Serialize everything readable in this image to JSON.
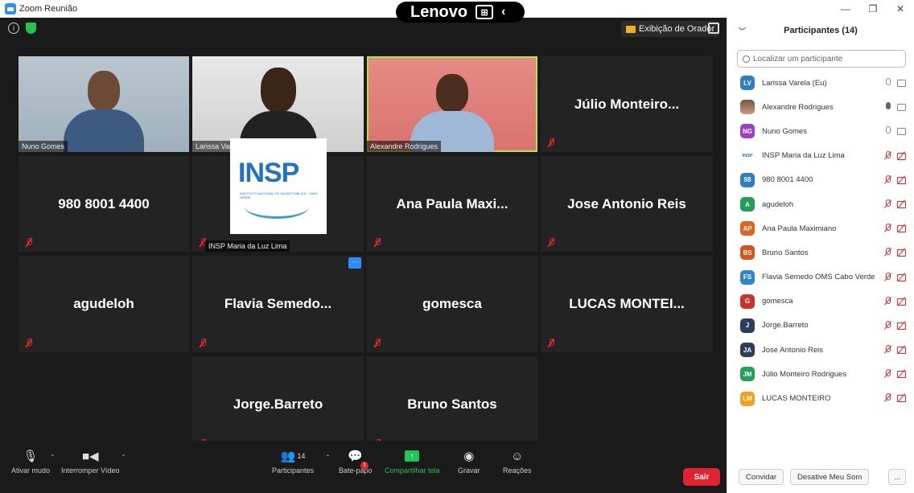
{
  "window": {
    "title": "Zoom Reunião",
    "controls": [
      "—",
      "❐",
      "✕"
    ]
  },
  "overlay": {
    "brand": "Lenovo"
  },
  "topbar": {
    "speaker_view_label": "Exibição de Orador"
  },
  "tiles": [
    {
      "type": "video",
      "label": "Nuno Gomes"
    },
    {
      "type": "video",
      "label": "Larissa Varela"
    },
    {
      "type": "video",
      "label": "Alexandre Rodrigues",
      "active": true
    },
    {
      "type": "name",
      "name": "Júlio  Monteiro..."
    },
    {
      "type": "name",
      "name": "980 8001 4400"
    },
    {
      "type": "logo",
      "label": "INSP Maria da Luz Lima",
      "logo_text": "INSP",
      "logo_sub": "INSTITUTO NACIONAL DE SAÚDE PÚBLICA · CABO VERDE"
    },
    {
      "type": "name",
      "name": "Ana Paula Maxi..."
    },
    {
      "type": "name",
      "name": "Jose Antonio Reis"
    },
    {
      "type": "name",
      "name": "agudeloh"
    },
    {
      "type": "name",
      "name": "Flavia  Semedo..."
    },
    {
      "type": "name",
      "name": "gomesca"
    },
    {
      "type": "name",
      "name": "LUCAS  MONTEI..."
    },
    {
      "type": "name",
      "name": "Jorge.Barreto"
    },
    {
      "type": "name",
      "name": "Bruno Santos"
    }
  ],
  "more_button": "···",
  "toolbar": {
    "mute": "Ativar mudo",
    "video": "Interromper Vídeo",
    "participants": "Participantes",
    "participants_count": "14",
    "chat": "Bate-papo",
    "chat_badge": "1",
    "share": "Compartilhar tela",
    "record": "Gravar",
    "reactions": "Reações",
    "leave": "Sair"
  },
  "panel": {
    "title": "Participantes (14)",
    "search_placeholder": "Localizar um participante",
    "participants": [
      {
        "initials": "LV",
        "name": "Larissa Varela (Eu)",
        "color": "#2e7ec2",
        "mic": "on",
        "cam": "on"
      },
      {
        "initials": "",
        "name": "Alexandre Rodrigues",
        "color": "#a0705a",
        "mic": "speaking",
        "cam": "on"
      },
      {
        "initials": "NG",
        "name": "Nuno Gomes",
        "color": "#9b3fc4",
        "mic": "on",
        "cam": "on"
      },
      {
        "initials": "INSP",
        "name": "INSP Maria da Luz Lima",
        "color": "#ffffff",
        "mic": "off",
        "cam": "off"
      },
      {
        "initials": "98",
        "name": "980 8001 4400",
        "color": "#2e7ec2",
        "mic": "off",
        "cam": "off"
      },
      {
        "initials": "A",
        "name": "agudeloh",
        "color": "#22a05a",
        "mic": "off",
        "cam": "off"
      },
      {
        "initials": "AP",
        "name": "Ana Paula Maximiano",
        "color": "#e0641e",
        "mic": "off",
        "cam": "off"
      },
      {
        "initials": "BS",
        "name": "Bruno Santos",
        "color": "#d9541a",
        "mic": "off",
        "cam": "off"
      },
      {
        "initials": "FS",
        "name": "Flavia Semedo OMS Cabo Verde",
        "color": "#2e86c9",
        "mic": "off",
        "cam": "off"
      },
      {
        "initials": "G",
        "name": "gomesca",
        "color": "#c9342a",
        "mic": "off",
        "cam": "off"
      },
      {
        "initials": "J",
        "name": "Jorge.Barreto",
        "color": "#2c3e5a",
        "mic": "off",
        "cam": "off"
      },
      {
        "initials": "JA",
        "name": "Jose Antonio Reis",
        "color": "#2c3e5a",
        "mic": "off",
        "cam": "off"
      },
      {
        "initials": "JM",
        "name": "Júlio Monteiro Rodrigues",
        "color": "#22a05a",
        "mic": "off",
        "cam": "off"
      },
      {
        "initials": "LM",
        "name": "LUCAS MONTEIRO",
        "color": "#f2a11e",
        "mic": "off",
        "cam": "off"
      }
    ],
    "invite": "Convidar",
    "mute_me": "Desative Meu Som",
    "more": "..."
  }
}
